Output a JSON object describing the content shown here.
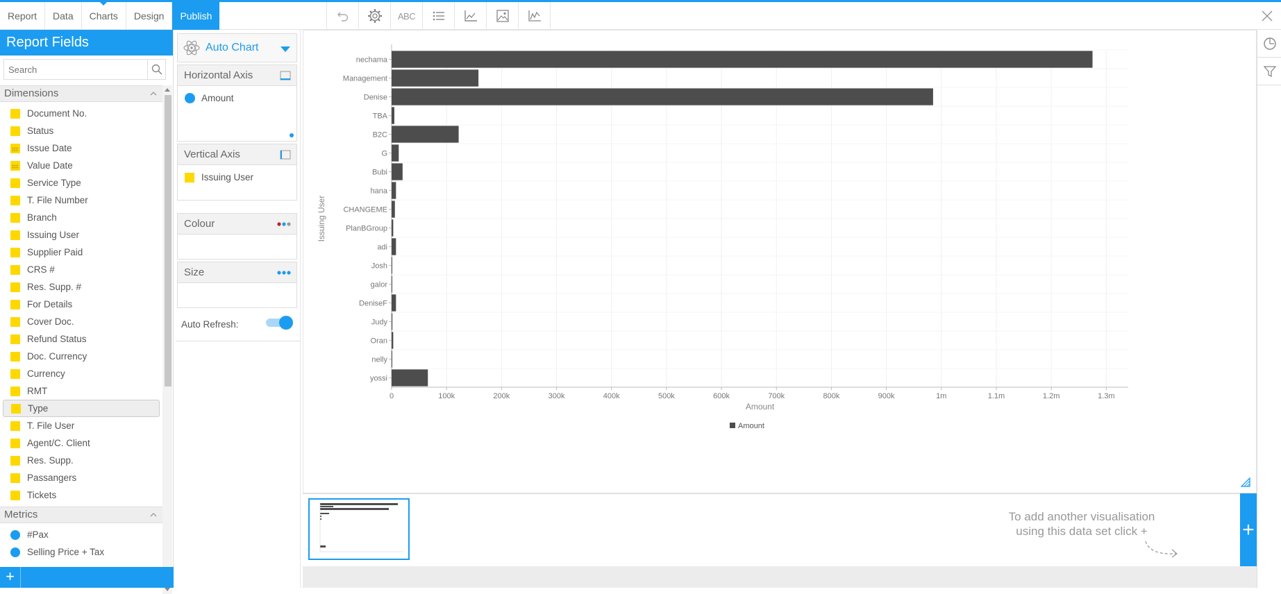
{
  "tabs": [
    "Report",
    "Data",
    "Charts",
    "Design",
    "Publish"
  ],
  "toolbar": {
    "undo_icon": "undo-icon",
    "settings_icon": "gear-icon",
    "text_label": "ABC",
    "list_icon": "list-icon",
    "axis_icon": "axis-icon",
    "image_icon": "image-icon",
    "series_icon": "line-chart-icon"
  },
  "left_panel": {
    "title": "Report Fields",
    "search_placeholder": "Search",
    "dimensions_title": "Dimensions",
    "dimensions": [
      {
        "label": "Document No.",
        "kind": "text"
      },
      {
        "label": "Status",
        "kind": "text"
      },
      {
        "label": "Issue Date",
        "kind": "date"
      },
      {
        "label": "Value Date",
        "kind": "date"
      },
      {
        "label": "Service Type",
        "kind": "text"
      },
      {
        "label": "T. File Number",
        "kind": "text"
      },
      {
        "label": "Branch",
        "kind": "text"
      },
      {
        "label": "Issuing User",
        "kind": "text"
      },
      {
        "label": "Supplier Paid",
        "kind": "text"
      },
      {
        "label": "CRS #",
        "kind": "text"
      },
      {
        "label": "Res. Supp. #",
        "kind": "text"
      },
      {
        "label": "For Details",
        "kind": "text"
      },
      {
        "label": "Cover Doc.",
        "kind": "text"
      },
      {
        "label": "Refund Status",
        "kind": "text"
      },
      {
        "label": "Doc. Currency",
        "kind": "text"
      },
      {
        "label": "Currency",
        "kind": "text"
      },
      {
        "label": "RMT",
        "kind": "text"
      },
      {
        "label": "Type",
        "kind": "text",
        "selected": true
      },
      {
        "label": "T. File User",
        "kind": "text"
      },
      {
        "label": "Agent/C. Client",
        "kind": "text"
      },
      {
        "label": "Res. Supp.",
        "kind": "text"
      },
      {
        "label": "Passangers",
        "kind": "text"
      },
      {
        "label": "Tickets",
        "kind": "text"
      }
    ],
    "metrics_title": "Metrics",
    "metrics": [
      {
        "label": "#Pax"
      },
      {
        "label": "Selling Price + Tax"
      }
    ]
  },
  "config": {
    "chart_type_label": "Auto Chart",
    "horizontal_axis_title": "Horizontal Axis",
    "horizontal_axis_field": "Amount",
    "vertical_axis_title": "Vertical Axis",
    "vertical_axis_field": "Issuing User",
    "colour_title": "Colour",
    "size_title": "Size",
    "auto_refresh_label": "Auto Refresh:",
    "auto_refresh_on": true
  },
  "chart_data": {
    "type": "bar",
    "orientation": "horizontal",
    "categories": [
      "nechama",
      "Management",
      "Denise",
      "TBA",
      "B2C",
      "G",
      "Bubi",
      "hana",
      "CHANGEME",
      "PlanBGroup",
      "adi",
      "Josh",
      "galor",
      "DeniseF",
      "Judy",
      "Oran",
      "nelly",
      "yossi"
    ],
    "series": [
      {
        "name": "Amount",
        "values": [
          1275000,
          158000,
          985000,
          5000,
          122000,
          13000,
          20000,
          8000,
          6000,
          3000,
          8000,
          500,
          1000,
          8000,
          1500,
          3000,
          1000,
          66000
        ]
      }
    ],
    "xlabel": "Amount",
    "ylabel": "Issuing User",
    "xlim": [
      0,
      1340000
    ],
    "xticks": [
      0,
      100000,
      200000,
      300000,
      400000,
      500000,
      600000,
      700000,
      800000,
      900000,
      1000000,
      1100000,
      1200000,
      1300000
    ],
    "xtick_labels": [
      "0",
      "100k",
      "200k",
      "300k",
      "400k",
      "500k",
      "600k",
      "700k",
      "800k",
      "900k",
      "1m",
      "1.1m",
      "1.2m",
      "1.3m"
    ],
    "legend": "bottom-center",
    "grid": true,
    "bar_color": "#4d4d4d"
  },
  "thumbnails": {
    "hint": "To add another visualisation using this data set click +"
  },
  "colors": {
    "accent": "#1b9cf0",
    "dimension": "#ffd800"
  }
}
